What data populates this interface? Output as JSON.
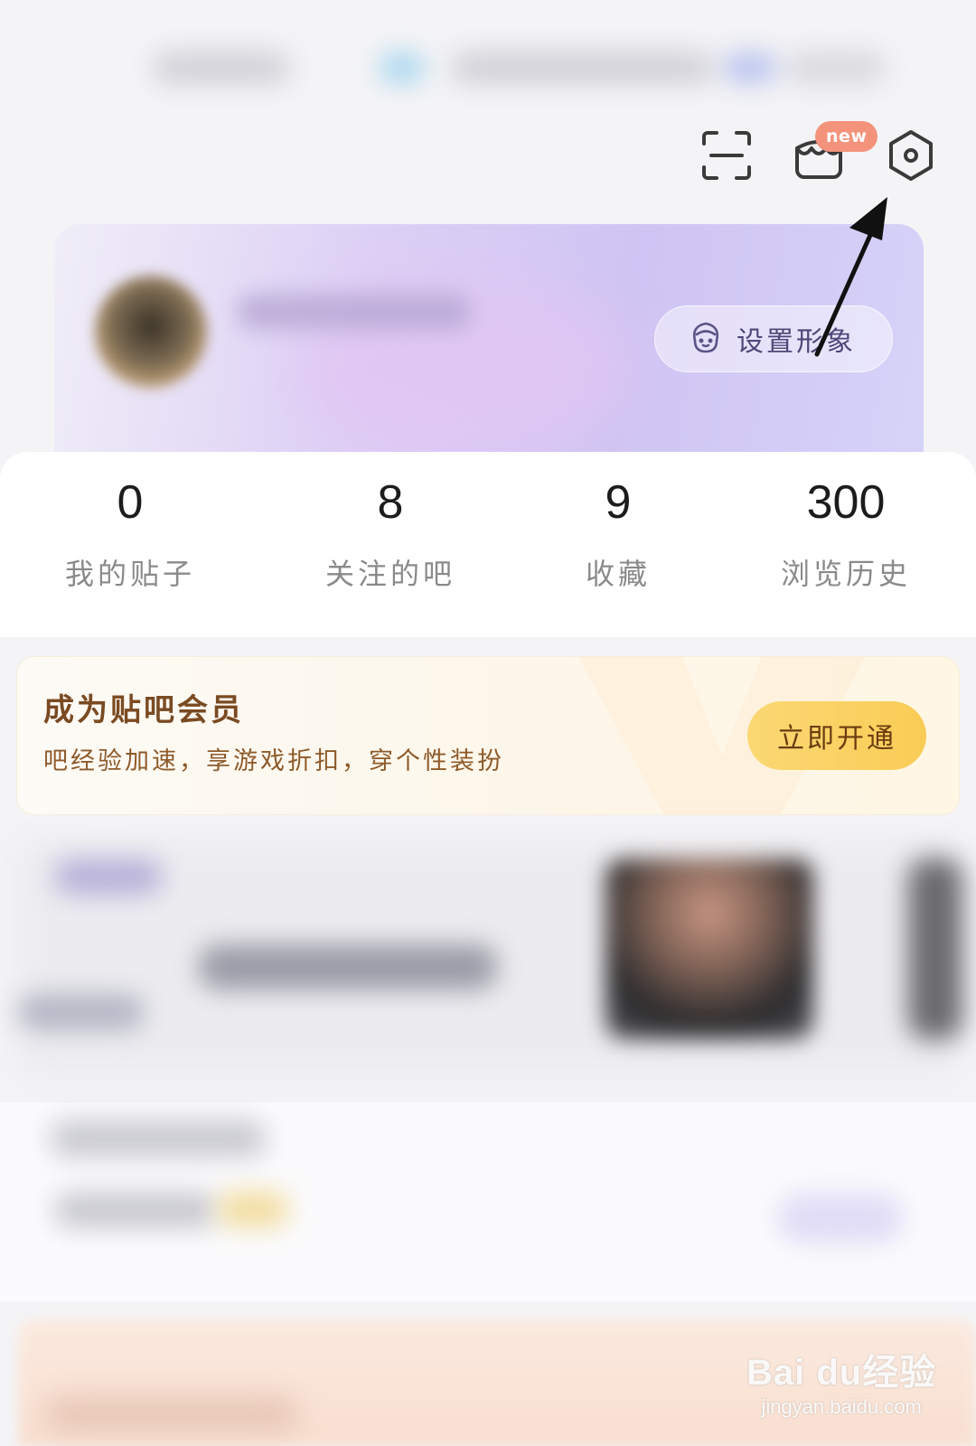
{
  "top_bar": {
    "new_badge": "new",
    "icons": [
      "scan-icon",
      "shop-icon",
      "settings-icon"
    ]
  },
  "profile": {
    "set_avatar_label": "设置形象"
  },
  "stats": [
    {
      "value": "0",
      "label": "我的贴子"
    },
    {
      "value": "8",
      "label": "关注的吧"
    },
    {
      "value": "9",
      "label": "收藏"
    },
    {
      "value": "300",
      "label": "浏览历史"
    }
  ],
  "vip": {
    "title": "成为贴吧会员",
    "subtitle": "吧经验加速，享游戏折扣，穿个性装扮",
    "button": "立即开通"
  },
  "watermark": {
    "brand": "Bai du经验",
    "url": "jingyan.baidu.com"
  },
  "colors": {
    "accent_purple": "#cfc4f3",
    "vip_button": "#f9cc55",
    "new_badge": "#f3937c"
  }
}
